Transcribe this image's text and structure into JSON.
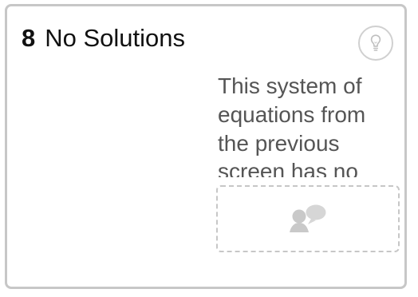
{
  "card": {
    "number": "8",
    "title": "No Solutions",
    "prompt": "This system of equations from the previous screen has no",
    "hint_icon": "lightbulb-icon",
    "response_icon": "discussion-bubble-icon"
  }
}
